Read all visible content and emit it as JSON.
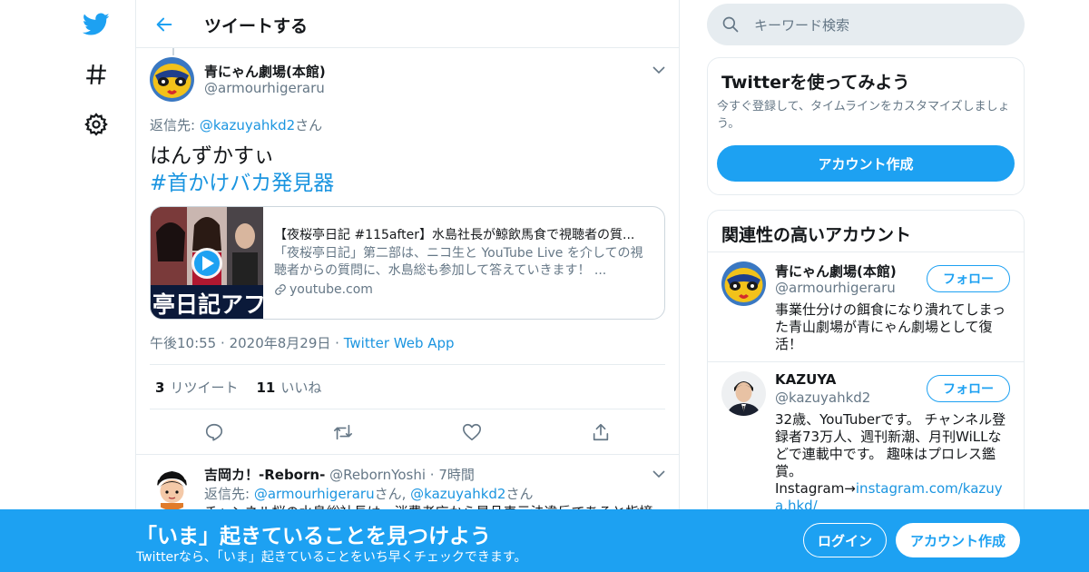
{
  "colors": {
    "accent": "#1da1f2",
    "link": "#1b95e0",
    "muted": "#657786",
    "border": "#e6ecf0",
    "text": "#14171a"
  },
  "nav": {
    "icons": [
      "twitter-bird-icon",
      "hashtag-icon",
      "gear-icon"
    ]
  },
  "header": {
    "title": "ツイートする"
  },
  "tweet": {
    "display_name": "青にゃん劇場(本館)",
    "handle": "@armourhigeraru",
    "reply_prefix": "返信先: ",
    "reply_handle": "@kazuyahkd2",
    "reply_suffix": "さん",
    "text_line1": "はんずかすぃ",
    "hashtag": "#首かけバカ発見器",
    "card": {
      "thumb_caption": "亭日記アフ",
      "title": "【夜桜亭日記 #115after】水島社長が鯨飲馬食で視聴者の質...",
      "description": "「夜桜亭日記」第二部は、ニコ生と YouTube Live を介しての視聴者からの質問に、水島総も参加して答えていきます！ ...",
      "domain": "youtube.com"
    },
    "time": "午後10:55",
    "date": "2020年8月29日",
    "sep": "·",
    "source": "Twitter Web App",
    "retweet_count": "3",
    "retweet_label": "リツイート",
    "like_count": "11",
    "like_label": "いいね"
  },
  "reply": {
    "display_name": "吉岡カ！-Reborn-",
    "handle": "@RebornYoshi",
    "sep": "·",
    "age": "7時間",
    "reply_prefix": "返信先: ",
    "reply_handle1": "@armourhigeraru",
    "reply_mid": "さん, ",
    "reply_handle2": "@kazuyahkd2",
    "reply_suffix": "さん",
    "text": "チャンネル桜の水島総社長は、消費者庁から景品表示法違反であると指摘"
  },
  "search": {
    "placeholder": "キーワード検索"
  },
  "signup_panel": {
    "title": "Twitterを使ってみよう",
    "text": "今すぐ登録して、タイムラインをカスタマイズしましょう。",
    "button": "アカウント作成"
  },
  "related": {
    "title": "関連性の高いアカウント",
    "follow_label": "フォロー",
    "accounts": [
      {
        "name": "青にゃん劇場(本館)",
        "handle": "@armourhigeraru",
        "bio": "事業仕分けの餌食になり潰れてしまった青山劇場が青にゃん劇場として復活！"
      },
      {
        "name": "KAZUYA",
        "handle": "@kazuyahkd2",
        "bio": "32歳、YouTuberです。 チャンネル登録者73万人、週刊新潮、月刊WiLLなどで連載中です。 趣味はプロレス鑑賞。",
        "bio_prefix": "Instagram→",
        "bio_link": "instagram.com/kazuya.hkd/"
      }
    ]
  },
  "banner": {
    "title": "「いま」起きていることを見つけよう",
    "subtitle": "Twitterなら、「いま」起きていることをいち早くチェックできます。",
    "login": "ログイン",
    "signup": "アカウント作成"
  }
}
